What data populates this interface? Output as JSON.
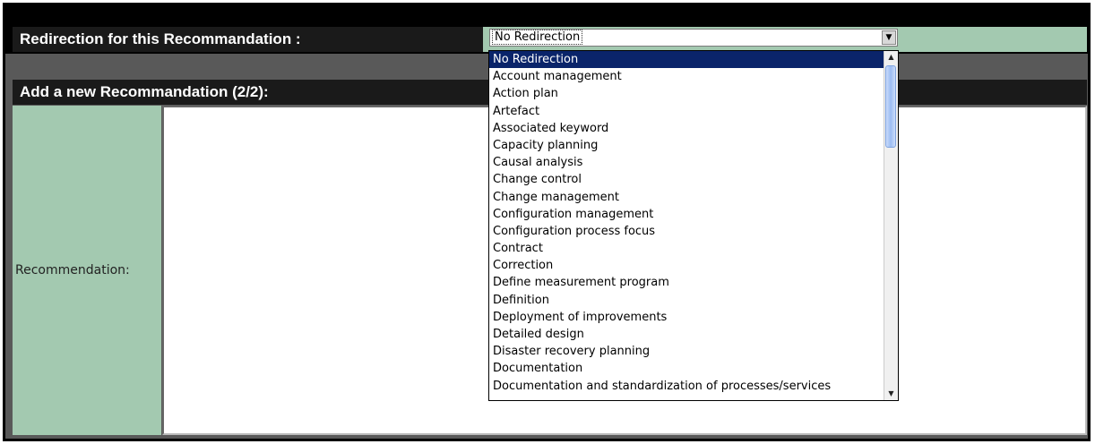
{
  "redirection": {
    "label": "Redirection for this Recommandation :",
    "selected": "No Redirection"
  },
  "new_recommandation": {
    "header": "Add a new Recommandation (2/2):",
    "field_label": "Recommendation:",
    "field_value": ""
  },
  "dropdown": {
    "options": [
      "No Redirection",
      "Account management",
      "Action plan",
      "Artefact",
      "Associated keyword",
      "Capacity planning",
      "Causal analysis",
      "Change control",
      "Change management",
      "Configuration management",
      "Configuration process focus",
      "Contract",
      "Correction",
      "Define measurement program",
      "Definition",
      "Deployment of improvements",
      "Detailed design",
      "Disaster recovery planning",
      "Documentation",
      "Documentation and standardization of processes/services"
    ],
    "selected_index": 0
  },
  "colors": {
    "header_bg": "#1a1a1a",
    "label_bg": "#a3c9b0",
    "frame_bg": "#595959",
    "selection": "#0a246a"
  },
  "icons": {
    "select_arrow": "chevron-down-icon",
    "scroll_up": "arrow-up-icon",
    "scroll_down": "arrow-down-icon"
  }
}
